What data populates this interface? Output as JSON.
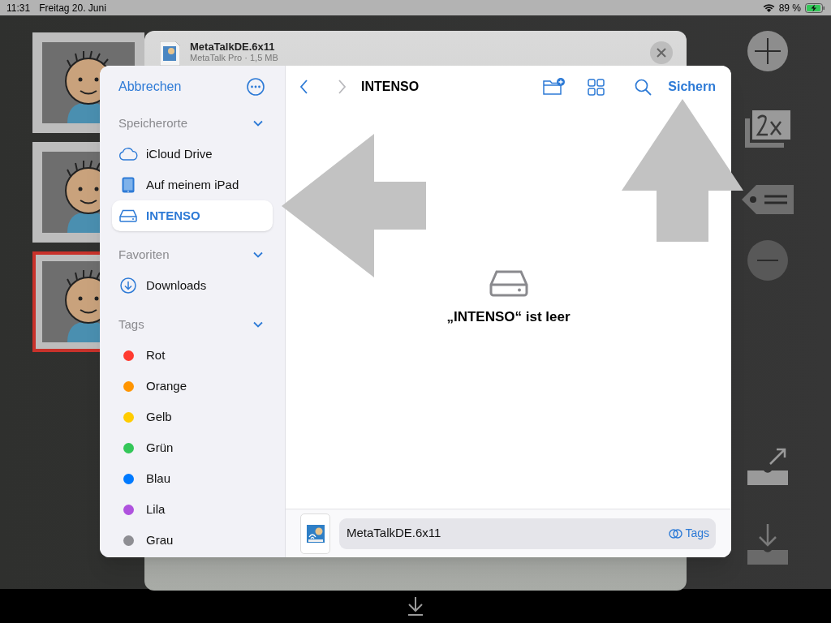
{
  "status_bar": {
    "time": "11:31",
    "date": "Freitag 20. Juni",
    "battery": "89 %"
  },
  "thumbnails": [
    {
      "selected": false
    },
    {
      "selected": false
    },
    {
      "selected": true
    }
  ],
  "background_sheet": {
    "title": "MetaTalkDE.6x11",
    "subtitle": "MetaTalk Pro · 1,5 MB"
  },
  "dialog": {
    "cancel": "Abbrechen",
    "sections": [
      {
        "title": "Speicherorte",
        "expanded": true,
        "items": [
          {
            "label": "iCloud Drive",
            "kind": "cloud",
            "selected": false
          },
          {
            "label": "Auf meinem iPad",
            "kind": "ipad",
            "selected": false
          },
          {
            "label": "INTENSO",
            "kind": "drive",
            "selected": true
          }
        ]
      },
      {
        "title": "Favoriten",
        "expanded": true,
        "items": [
          {
            "label": "Downloads",
            "kind": "download",
            "selected": false
          }
        ]
      },
      {
        "title": "Tags",
        "expanded": true,
        "items": [
          {
            "label": "Rot",
            "kind": "tag",
            "color": "#ff3b30",
            "selected": false
          },
          {
            "label": "Orange",
            "kind": "tag",
            "color": "#ff9500",
            "selected": false
          },
          {
            "label": "Gelb",
            "kind": "tag",
            "color": "#ffcc00",
            "selected": false
          },
          {
            "label": "Grün",
            "kind": "tag",
            "color": "#34c759",
            "selected": false
          },
          {
            "label": "Blau",
            "kind": "tag",
            "color": "#007aff",
            "selected": false
          },
          {
            "label": "Lila",
            "kind": "tag",
            "color": "#af52de",
            "selected": false
          },
          {
            "label": "Grau",
            "kind": "tag",
            "color": "#8e8e93",
            "selected": false
          }
        ]
      }
    ],
    "nav": {
      "back": {
        "disabled": false
      },
      "forward": {
        "disabled": true
      },
      "title": "INTENSO"
    },
    "save": "Sichern",
    "empty_message": "„INTENSO“ ist leer",
    "filename": "MetaTalkDE.6x11",
    "tags_button": "Tags"
  }
}
